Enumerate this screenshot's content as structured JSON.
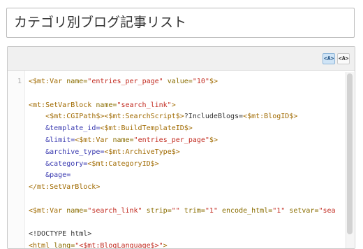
{
  "title_field": {
    "value": "カテゴリ別ブログ記事リスト"
  },
  "toolbar": {
    "rich_mode": "<A>",
    "plain_mode": "<A>"
  },
  "editor": {
    "first_line_number": "1",
    "lines": [
      [
        [
          "tg",
          "<$mt:Var "
        ],
        [
          "at",
          "name="
        ],
        [
          "st",
          "\"entries_per_page\""
        ],
        [
          "at",
          " value="
        ],
        [
          "st",
          "\"10\""
        ],
        [
          "tg",
          "$>"
        ]
      ],
      [],
      [
        [
          "tg",
          "<mt:SetVarBlock "
        ],
        [
          "at",
          "name="
        ],
        [
          "st",
          "\"search_link\""
        ],
        [
          "tg",
          ">"
        ]
      ],
      [
        [
          "pl",
          "    "
        ],
        [
          "tg",
          "<$mt:CGIPath$>"
        ],
        [
          "tg",
          "<$mt:SearchScript$>"
        ],
        [
          "pl",
          "?IncludeBlogs="
        ],
        [
          "tg",
          "<$mt:BlogID$>"
        ]
      ],
      [
        [
          "pl",
          "    "
        ],
        [
          "in",
          "&template_id="
        ],
        [
          "tg",
          "<$mt:BuildTemplateID$>"
        ]
      ],
      [
        [
          "pl",
          "    "
        ],
        [
          "in",
          "&limit="
        ],
        [
          "tg",
          "<$mt:Var "
        ],
        [
          "at",
          "name="
        ],
        [
          "st",
          "\"entries_per_page\""
        ],
        [
          "tg",
          "$>"
        ]
      ],
      [
        [
          "pl",
          "    "
        ],
        [
          "in",
          "&archive_type="
        ],
        [
          "tg",
          "<$mt:ArchiveType$>"
        ]
      ],
      [
        [
          "pl",
          "    "
        ],
        [
          "in",
          "&category="
        ],
        [
          "tg",
          "<$mt:CategoryID$>"
        ]
      ],
      [
        [
          "pl",
          "    "
        ],
        [
          "in",
          "&page="
        ]
      ],
      [
        [
          "tg",
          "</mt:SetVarBlock>"
        ]
      ],
      [],
      [
        [
          "tg",
          "<$mt:Var "
        ],
        [
          "at",
          "name="
        ],
        [
          "st",
          "\"search_link\""
        ],
        [
          "at",
          " strip="
        ],
        [
          "st",
          "\"\""
        ],
        [
          "at",
          " trim="
        ],
        [
          "st",
          "\"1\""
        ],
        [
          "at",
          " encode_html="
        ],
        [
          "st",
          "\"1\""
        ],
        [
          "at",
          " setvar="
        ],
        [
          "st",
          "\"sea"
        ]
      ],
      [],
      [
        [
          "pl",
          "<!DOCTYPE html>"
        ]
      ],
      [
        [
          "tg",
          "<html "
        ],
        [
          "at",
          "lang="
        ],
        [
          "st",
          "\"<$mt:BlogLanguage$>\""
        ],
        [
          "tg",
          ">"
        ]
      ]
    ]
  }
}
